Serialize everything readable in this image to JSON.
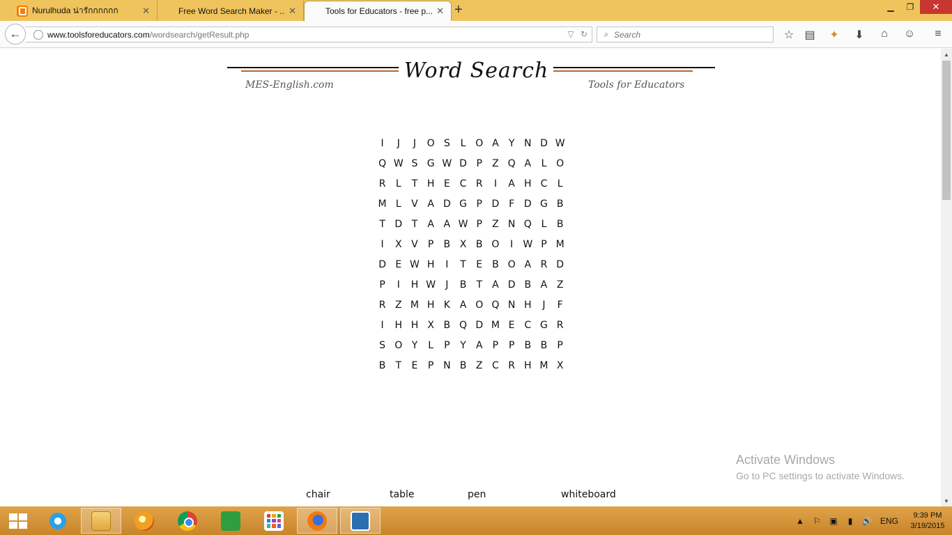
{
  "browser": {
    "tabs": [
      {
        "title": "Nurulhuda น่ารักกกกกก",
        "active": false
      },
      {
        "title": "Free Word Search Maker - ...",
        "active": false
      },
      {
        "title": "Tools for Educators - free p...",
        "active": true
      }
    ],
    "url_host": "www.toolsforeducators.com",
    "url_path": "/wordsearch/getResult.php",
    "search_placeholder": "Search"
  },
  "page": {
    "title": "Word Search",
    "site_left": "MES-English.com",
    "site_right": "Tools for Educators",
    "grid": [
      [
        "I",
        "J",
        "J",
        "O",
        "S",
        "L",
        "O",
        "A",
        "Y",
        "N",
        "D",
        "W"
      ],
      [
        "Q",
        "W",
        "S",
        "G",
        "W",
        "D",
        "P",
        "Z",
        "Q",
        "A",
        "L",
        "O"
      ],
      [
        "R",
        "L",
        "T",
        "H",
        "E",
        "C",
        "R",
        "I",
        "A",
        "H",
        "C",
        "L"
      ],
      [
        "M",
        "L",
        "V",
        "A",
        "D",
        "G",
        "P",
        "D",
        "F",
        "D",
        "G",
        "B"
      ],
      [
        "T",
        "D",
        "T",
        "A",
        "A",
        "W",
        "P",
        "Z",
        "N",
        "Q",
        "L",
        "B"
      ],
      [
        "I",
        "X",
        "V",
        "P",
        "B",
        "X",
        "B",
        "O",
        "I",
        "W",
        "P",
        "M"
      ],
      [
        "D",
        "E",
        "W",
        "H",
        "I",
        "T",
        "E",
        "B",
        "O",
        "A",
        "R",
        "D"
      ],
      [
        "P",
        "I",
        "H",
        "W",
        "J",
        "B",
        "T",
        "A",
        "D",
        "B",
        "A",
        "Z"
      ],
      [
        "R",
        "Z",
        "M",
        "H",
        "K",
        "A",
        "O",
        "Q",
        "N",
        "H",
        "J",
        "F"
      ],
      [
        "I",
        "H",
        "H",
        "X",
        "B",
        "Q",
        "D",
        "M",
        "E",
        "C",
        "G",
        "R"
      ],
      [
        "S",
        "O",
        "Y",
        "L",
        "P",
        "Y",
        "A",
        "P",
        "P",
        "B",
        "B",
        "P"
      ],
      [
        "B",
        "T",
        "E",
        "P",
        "N",
        "B",
        "Z",
        "C",
        "R",
        "H",
        "M",
        "X"
      ]
    ],
    "words": [
      "chair",
      "table",
      "pen",
      "whiteboard"
    ],
    "watermark_title": "Activate Windows",
    "watermark_sub": "Go to PC settings to activate Windows."
  },
  "taskbar": {
    "language": "ENG",
    "time": "9:39 PM",
    "date": "3/19/2015"
  },
  "colors": {
    "tabbar": "#f0c45d",
    "taskbar": "#d8952f",
    "header_accent": "#b5652b"
  }
}
